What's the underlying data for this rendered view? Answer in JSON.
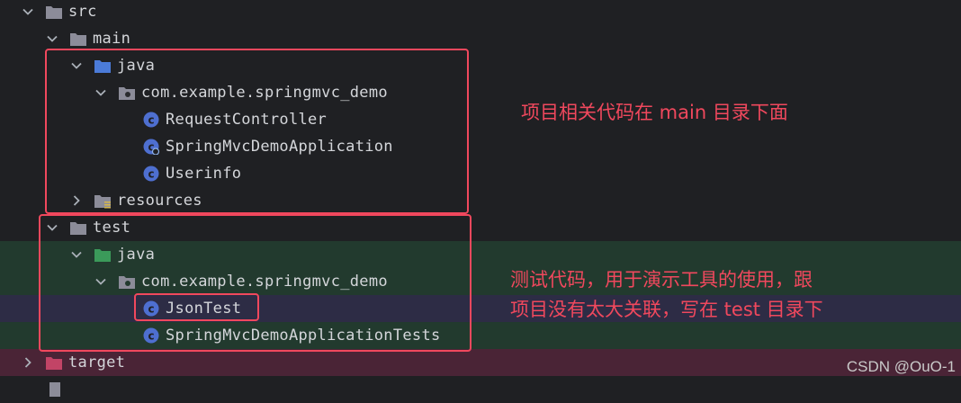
{
  "tree": {
    "src": "src",
    "main": "main",
    "main_java": "java",
    "main_package": "com.example.springmvc_demo",
    "request_controller": "RequestController",
    "app": "SpringMvcDemoApplication",
    "userinfo": "Userinfo",
    "resources": "resources",
    "test": "test",
    "test_java": "java",
    "test_package": "com.example.springmvc_demo",
    "json_test": "JsonTest",
    "app_tests": "SpringMvcDemoApplicationTests",
    "target": "target"
  },
  "annotations": {
    "main_note": "项目相关代码在 main 目录下面",
    "test_note_line1": "测试代码，用于演示工具的使用，跟",
    "test_note_line2": "项目没有太大关联，写在 test 目录下"
  },
  "watermark": "CSDN @OuO-1",
  "colors": {
    "highlight": "#f0485d",
    "folder": "#8c8c99",
    "source_folder": "#4b7bd8",
    "test_folder": "#3b9a5a",
    "excluded_folder": "#c24466",
    "class_icon": "#4e6fd0"
  }
}
